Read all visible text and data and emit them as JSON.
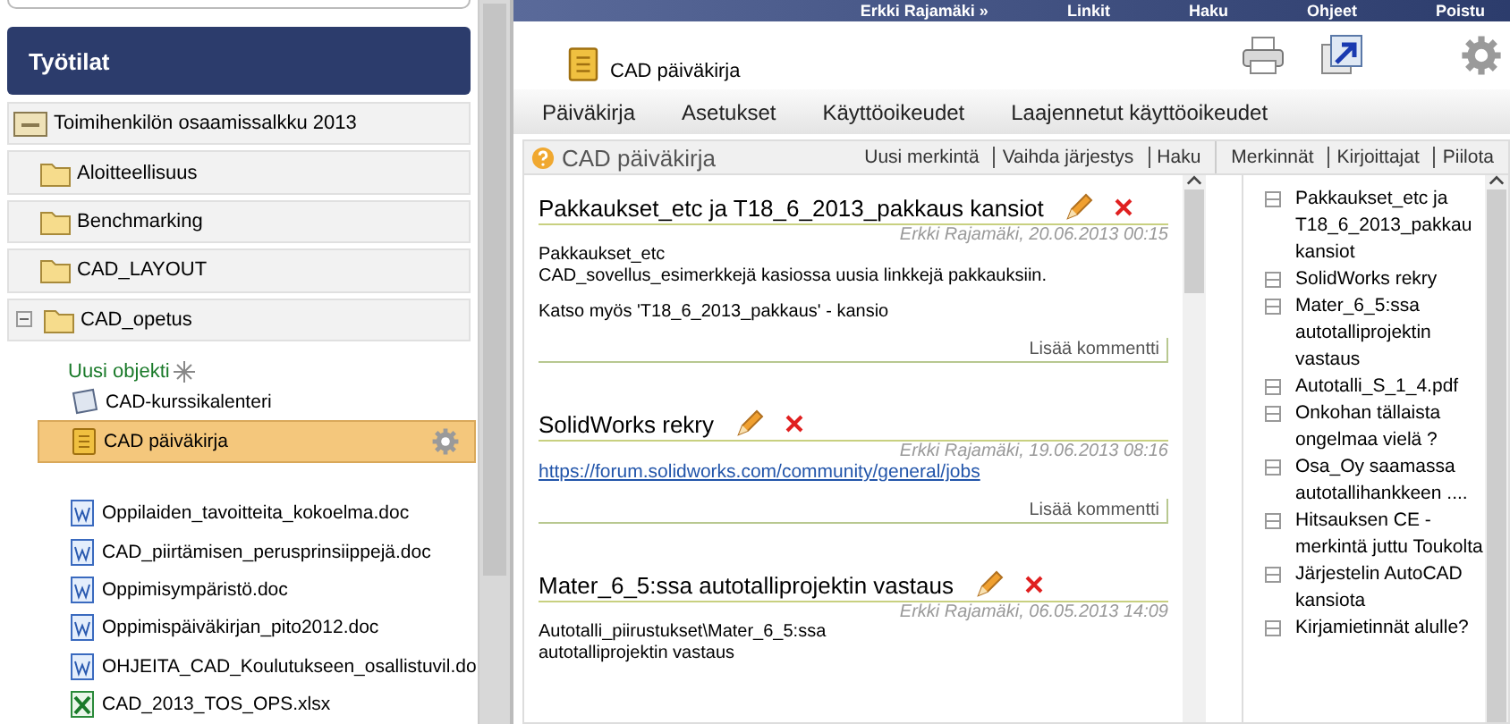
{
  "top_bar": {
    "items": [
      "Erkki Rajamäki »",
      "Linkit",
      "Haku",
      "Ohjeet",
      "Poistu"
    ]
  },
  "sidebar": {
    "title": "Työtilat",
    "workspace": {
      "label": "Toimihenkilön osaamissalkku 2013",
      "children": [
        {
          "kind": "folder",
          "label": "Aloitteellisuus",
          "expanded": false
        },
        {
          "kind": "folder",
          "label": "Benchmarking",
          "expanded": false
        },
        {
          "kind": "folder",
          "label": "CAD_LAYOUT",
          "expanded": false
        },
        {
          "kind": "folder",
          "label": "CAD_opetus",
          "expanded": true,
          "new_object_link": "Uusi objekti",
          "children": [
            {
              "kind": "calendar",
              "label": "CAD-kurssikalenteri",
              "selected": false
            },
            {
              "kind": "diary",
              "label": "CAD päiväkirja",
              "selected": true
            },
            {
              "kind": "doc",
              "label": "Oppilaiden_tavoitteita_kokoelma.doc",
              "selected": false
            },
            {
              "kind": "doc",
              "label": "CAD_piirtämisen_perusprinsiippejä.doc",
              "selected": false
            },
            {
              "kind": "doc",
              "label": "Oppimisympäristö.doc",
              "selected": false
            },
            {
              "kind": "doc",
              "label": "Oppimispäiväkirjan_pito2012.doc",
              "selected": false
            },
            {
              "kind": "doc",
              "label": "OHJEITA_CAD_Koulutukseen_osallistuvil.do",
              "selected": false
            },
            {
              "kind": "xlsx",
              "label": "CAD_2013_TOS_OPS.xlsx",
              "selected": false
            }
          ]
        }
      ]
    }
  },
  "main": {
    "title": "CAD päiväkirja",
    "tabs": [
      {
        "label": "Päiväkirja",
        "selected": false
      },
      {
        "label": "Asetukset",
        "selected": false
      },
      {
        "label": "Käyttöoikeudet",
        "selected": false
      },
      {
        "label": "Laajennetut käyttöoikeudet",
        "selected": false
      }
    ],
    "panel": {
      "title": "CAD päiväkirja",
      "actions": [
        "Uusi merkintä",
        "Vaihda järjestys",
        "Haku"
      ],
      "index_actions": [
        "Merkinnät",
        "Kirjoittajat",
        "Piilota"
      ],
      "entries": [
        {
          "title": "Pakkaukset_etc ja T18_6_2013_pakkaus kansiot",
          "meta": "Erkki Rajamäki, 20.06.2013 00:15",
          "body": [
            {
              "kind": "text",
              "lines": [
                "Pakkaukset_etc",
                "CAD_sovellus_esimerkkejä  kasiossa uusia linkkejä pakkauksiin."
              ]
            },
            {
              "kind": "text",
              "lines": [
                "Katso myös 'T18_6_2013_pakkaus' - kansio"
              ]
            }
          ],
          "comment_button": "Lisää kommentti"
        },
        {
          "title": "SolidWorks rekry",
          "meta": "Erkki Rajamäki, 19.06.2013 08:16",
          "body": [
            {
              "kind": "link",
              "lines": [
                "https://forum.solidworks.com/community/general/jobs"
              ]
            }
          ],
          "comment_button": "Lisää kommentti"
        },
        {
          "title": "Mater_6_5:ssa autotalliprojektin vastaus",
          "meta": "Erkki Rajamäki, 06.05.2013 14:09",
          "body": [
            {
              "kind": "text",
              "lines": [
                "Autotalli_piirustukset\\Mater_6_5:ssa",
                "autotalliprojektin vastaus"
              ]
            }
          ]
        }
      ],
      "index": [
        "Pakkaukset_etc ja T18_6_2013_pakkau kansiot",
        "SolidWorks rekry",
        "Mater_6_5:ssa autotalliprojektin vastaus",
        "Autotalli_S_1_4.pdf",
        "Onkohan tällaista ongelmaa vielä ?",
        "Osa_Oy saamassa autotallihankkeen ....",
        "Hitsauksen CE - merkintä juttu Toukolta",
        "Järjestelin AutoCAD kansiota",
        "Kirjamietinnät alulle?"
      ]
    }
  }
}
